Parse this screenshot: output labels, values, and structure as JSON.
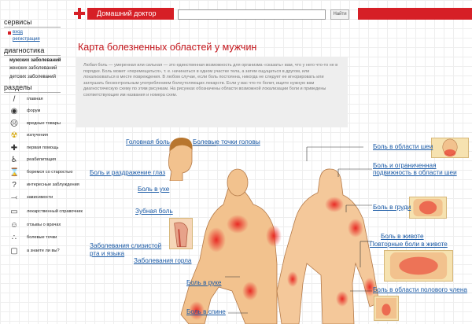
{
  "header": {
    "logo_text": "Домашний доктор",
    "search_value": "",
    "search_button": "Найти",
    "accent_color": "#d61f26"
  },
  "sidebar": {
    "services_title": "сервисы",
    "login": "вход",
    "register": "регистрация",
    "diagnostics_title": "диагностика",
    "diagnostics": [
      "мужских заболеваний",
      "женских заболеваний",
      "детских заболеваний"
    ],
    "sections_title": "разделы",
    "sections": [
      {
        "label": "главная",
        "icon": "slash-icon"
      },
      {
        "label": "форум",
        "icon": "eye-icon"
      },
      {
        "label": "вредные товары",
        "icon": "sad-face-icon"
      },
      {
        "label": "излучения",
        "icon": "radiation-icon"
      },
      {
        "label": "первая помощь",
        "icon": "first-aid-icon"
      },
      {
        "label": "реабилитация",
        "icon": "wheelchair-icon"
      },
      {
        "label": "боремся со старостью",
        "icon": "hourglass-icon"
      },
      {
        "label": "интересные заблуждения",
        "icon": "question-icon"
      },
      {
        "label": "зависимости",
        "icon": "syringe-icon"
      },
      {
        "label": "лекарственный справочник",
        "icon": "book-icon"
      },
      {
        "label": "отзывы о врачах",
        "icon": "doctor-icon"
      },
      {
        "label": "болевые точки",
        "icon": "points-icon"
      },
      {
        "label": "а знаете ли вы?",
        "icon": "speech-icon"
      }
    ]
  },
  "main": {
    "title": "Карта болезненных областей у мужчин",
    "intro": "Любая боль — умеренная или сильная — это единственная возможность для организма «сказать» вам, что у него что-то не в порядке. Боль может «перемещаться», т. е. начинаться в одном участке тела, а затем ощущаться в другом, или локализоваться в месте повреждения. В любом случае, если боль постоянна, никогда не следует ее игнорировать или заглушать бесконтрольным употреблением болеутоляющих лекарств. Если у вас что-то болит, ищите нужную вам диагностическую схему по этим рисункам. На рисунках обозначены области возможной локализации боли и приведены соответствующие им названия и номера схем."
  },
  "labels": {
    "headache": "Головная боль",
    "head_points": "Болевые точки головы",
    "neck_area": "Боль в области шеи",
    "eye_pain": "Боль и раздражение глаз",
    "neck_mobility_1": "Боль и ограниченная",
    "neck_mobility_2": "подвижность в области шеи",
    "ear_pain": "Боль в ухе",
    "chest_pain": "Боль в груди",
    "toothache": "Зубная боль",
    "abdominal": "Боль в животе",
    "recurring_abdominal": "Повторные боли в животе",
    "mouth_1": "Заболевания слизистой",
    "mouth_2": "рта и языка",
    "throat": "Заболевания горла",
    "arm_pain": "Боль в руке",
    "genital": "Боль в области полового члена",
    "back_pain": "Боль в спине"
  }
}
